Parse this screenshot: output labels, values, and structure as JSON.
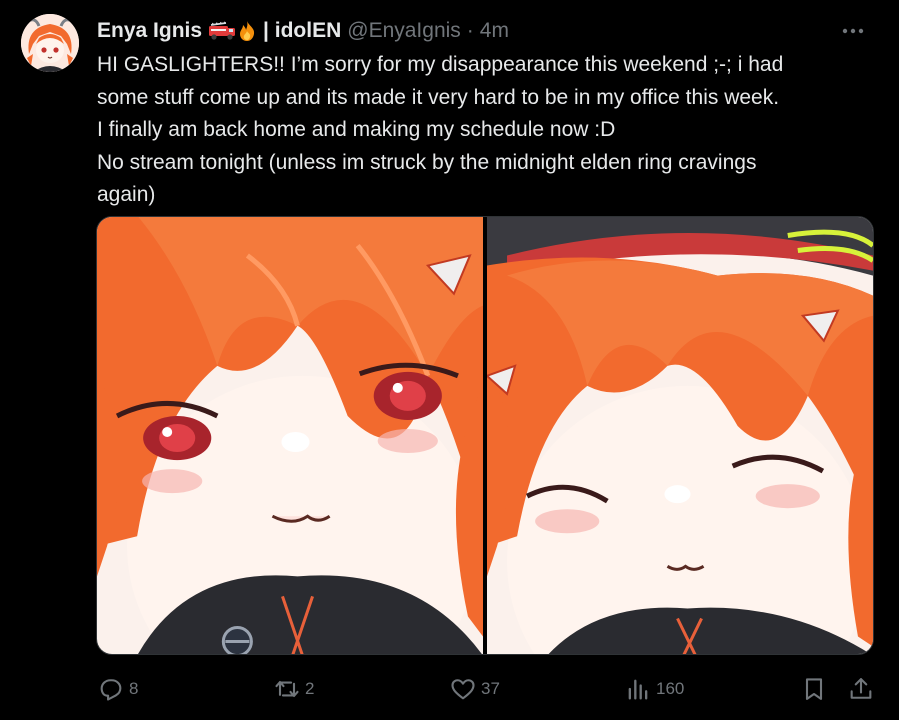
{
  "author": {
    "display_name": "Enya Ignis",
    "emoji": [
      "fire-truck",
      "fire"
    ],
    "affiliation": "| idolEN",
    "handle": "@EnyaIgnis",
    "separator": "·",
    "time": "4m"
  },
  "tweet_text": [
    "HI GASLIGHTERS!! I’m sorry for my disappearance this weekend ;-; i had",
    "some stuff come up and its made it very hard to be in my office this week.",
    "I finally am back home and making my schedule now :D",
    "No stream tonight (unless im struck by the midnight elden ring cravings",
    "again)"
  ],
  "media": {
    "images": [
      {
        "subject": "orange-haired anime girl smiling, eyes open"
      },
      {
        "subject": "orange-haired anime girl with cap, eyes closed smiling"
      }
    ]
  },
  "actions": {
    "replies": "8",
    "reposts": "2",
    "likes": "37",
    "views": "160"
  },
  "colors": {
    "background": "#000000",
    "text_primary": "#e7e9ea",
    "text_secondary": "#71767b",
    "hair_orange": "#f2622b",
    "border": "#2f3336"
  }
}
